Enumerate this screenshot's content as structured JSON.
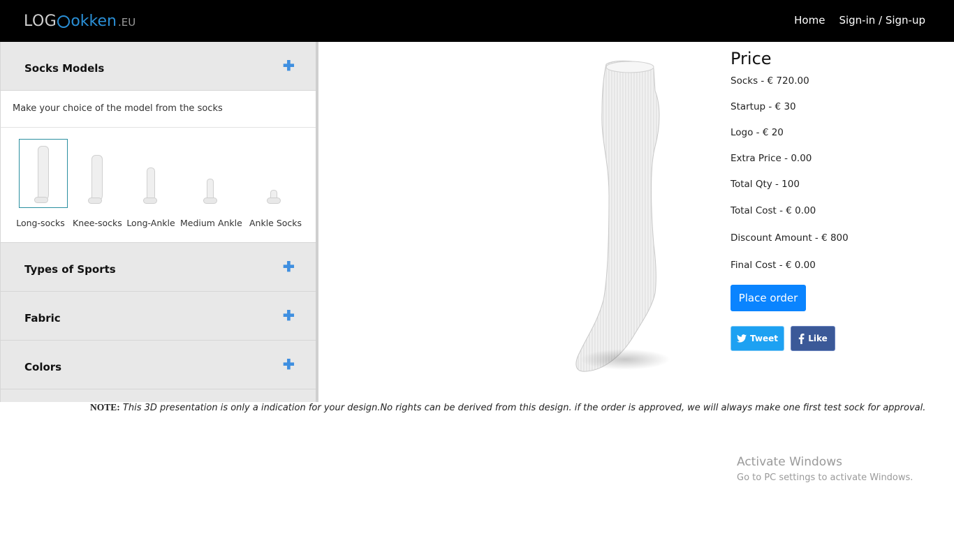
{
  "header": {
    "logo": {
      "part_a": "LOG",
      "part_b": "okken",
      "part_c": ".EU"
    },
    "nav": [
      {
        "label": "Home"
      },
      {
        "label": "Sign-in / Sign-up"
      }
    ]
  },
  "sidebar": {
    "sections": [
      {
        "title": "Socks Models",
        "icon": "plus-icon"
      },
      {
        "title": "Types of Sports",
        "icon": "plus-icon"
      },
      {
        "title": "Fabric",
        "icon": "plus-icon"
      },
      {
        "title": "Colors",
        "icon": "plus-icon"
      }
    ],
    "models_description": "Make your choice of the model from the socks",
    "models": [
      {
        "label": "Long-socks",
        "selected": true
      },
      {
        "label": "Knee-socks",
        "selected": false
      },
      {
        "label": "Long-Ankle",
        "selected": false
      },
      {
        "label": "Medium Ankle",
        "selected": false
      },
      {
        "label": "Ankle Socks",
        "selected": false
      }
    ]
  },
  "price": {
    "title": "Price",
    "rows": [
      "Socks - € 720.00",
      "Startup - € 30",
      "Logo - € 20",
      "Extra Price - 0.00",
      "Total Qty - 100",
      "Total Cost - €  0.00",
      "Discount Amount - € 800",
      "Final Cost - €  0.00"
    ],
    "order_button": "Place order",
    "tweet_button": "Tweet",
    "like_button": "Like"
  },
  "note": {
    "label": "NOTE:",
    "text": " This 3D presentation is only a indication for your design.No rights can be derived from this design. if the order is approved, we will always make one first test sock for approval."
  },
  "watermark": {
    "line1": "Activate Windows",
    "line2": "Go to PC settings to activate Windows."
  },
  "colors": {
    "header_bg": "#000000",
    "accent_blue": "#0a84ff",
    "twitter": "#1da1f2",
    "facebook": "#3b5998"
  }
}
